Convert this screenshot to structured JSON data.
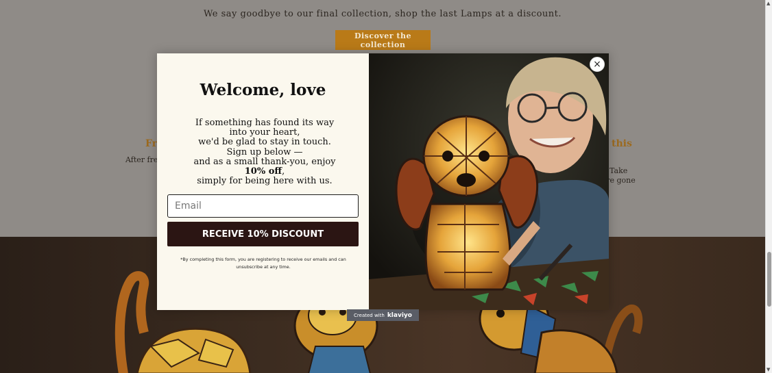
{
  "banner": {
    "announcement": "We say goodbye to our final collection, shop the last Lamps at a discount.",
    "cta_label": "Discover the collection"
  },
  "features": {
    "left_title": "Fr",
    "left_text": "After free",
    "right_title": "this",
    "right_line1": "g.  Take",
    "right_line2": "y're gone"
  },
  "popup": {
    "title": "Welcome, love",
    "body_line1": "If something has found its way into your heart,",
    "body_line2": "we'd be glad to stay in touch.",
    "body_line3": "Sign up below —",
    "body_line4a": "and as a small thank-you, enjoy ",
    "body_line4_bold": "10% off",
    "body_line4b": ",",
    "body_line5": "simply for being here with us.",
    "email_placeholder": "Email",
    "submit_label": "RECEIVE 10% DISCOUNT",
    "disclaimer": "*By completing this form, you are registering to receive our emails and can unsubscribe at any time.",
    "close_icon": "×"
  },
  "badge": {
    "prefix": "Created with",
    "brand": "klaviyo"
  },
  "colors": {
    "accent_gold": "#b97a18",
    "button_dark": "#2b1513",
    "popup_bg": "#fbf8ee"
  }
}
